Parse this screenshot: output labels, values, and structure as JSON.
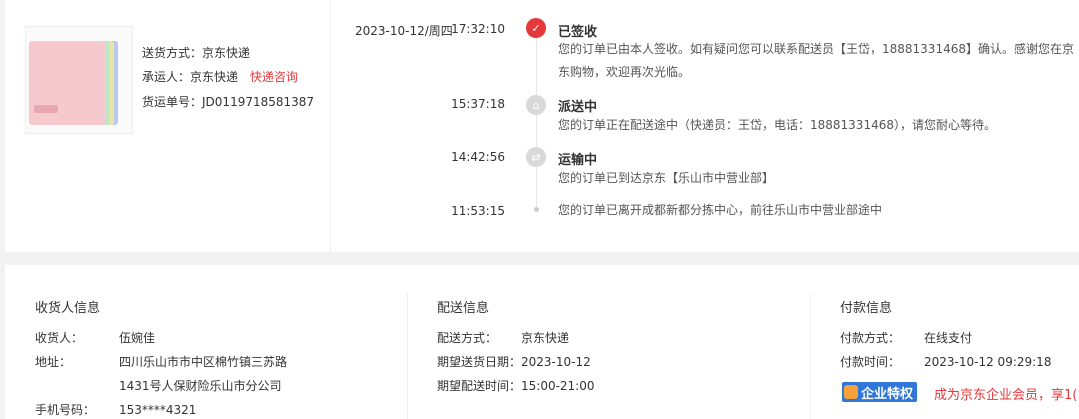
{
  "shipment": {
    "method_label": "送货方式：",
    "method_value": "京东快递",
    "carrier_label": "承运人：",
    "carrier_value": "京东快递",
    "carrier_link": "快递咨询",
    "tracking_label": "货运单号：",
    "tracking_value": "JD0119718581387"
  },
  "tracking": {
    "date": "2023-10-12/周四",
    "events": [
      {
        "time": "17:32:10",
        "status": "已签收",
        "desc": "您的订单已由本人签收。如有疑问您可以联系配送员【王岱，18881331468】确认。感谢您在京东购物，欢迎再次光临。"
      },
      {
        "time": "15:37:18",
        "status": "派送中",
        "desc": "您的订单正在配送途中（快递员：王岱，电话：18881331468），请您耐心等待。"
      },
      {
        "time": "14:42:56",
        "status": "运输中",
        "desc": "您的订单已到达京东【乐山市中营业部】"
      },
      {
        "time": "11:53:15",
        "status": "",
        "desc": "您的订单已离开成都新都分拣中心，前往乐山市中营业部途中"
      }
    ]
  },
  "receiver": {
    "title": "收货人信息",
    "name_label": "收货人：",
    "name_value": "伍婉佳",
    "addr_label": "地址：",
    "addr_line1": "四川乐山市市中区棉竹镇三苏路",
    "addr_line2": "1431号人保财险乐山市分公司",
    "phone_label": "手机号码：",
    "phone_value": "153****4321"
  },
  "delivery": {
    "title": "配送信息",
    "method_label": "配送方式：",
    "method_value": "京东快递",
    "date_label": "期望送货日期：",
    "date_value": "2023-10-12",
    "time_label": "期望配送时间：",
    "time_value": "15:00-21:00"
  },
  "payment": {
    "title": "付款信息",
    "method_label": "付款方式：",
    "method_value": "在线支付",
    "time_label": "付款时间：",
    "time_value": "2023-10-12 09:29:18",
    "badge": "企业特权",
    "promo": "成为京东企业会员，享1("
  },
  "colors": {
    "accent": "#e4393c",
    "badge": "#2f76d8"
  }
}
